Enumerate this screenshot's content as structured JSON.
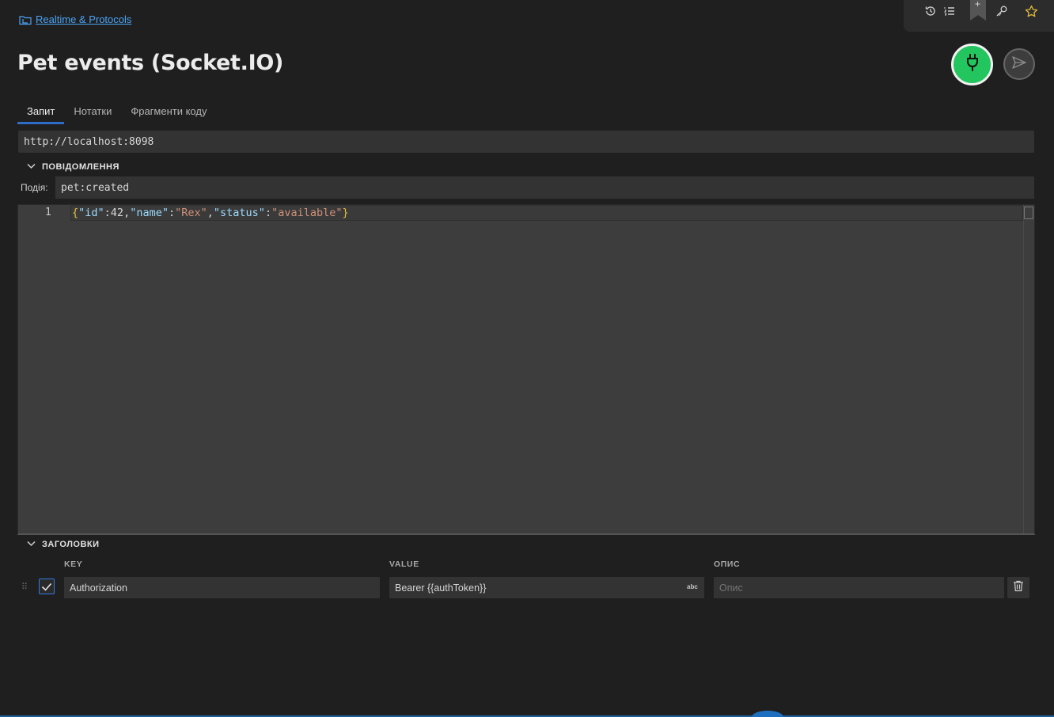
{
  "breadcrumb": {
    "label": "Realtime & Protocols",
    "icon": "folder-link-icon"
  },
  "toolbar": {
    "icons": [
      "history-icon",
      "list-icon",
      "bookmark-icon",
      "key-icon",
      "star-icon"
    ],
    "bookmark_plus": "+"
  },
  "page": {
    "title": "Pet events (Socket.IO)"
  },
  "actions": {
    "connect_icon": "plug-icon",
    "send_icon": "send-icon",
    "connect_color": "#22c55e"
  },
  "tabs": [
    {
      "label": "Запит",
      "active": true
    },
    {
      "label": "Нотатки",
      "active": false
    },
    {
      "label": "Фрагменти коду",
      "active": false
    }
  ],
  "url": {
    "value": "http://localhost:8098"
  },
  "message": {
    "section_label": "ПОВІДОМЛЕННЯ",
    "event_label": "Подія:",
    "event_value": "pet:created",
    "line_number": "1",
    "code": "{\"id\":42,\"name\":\"Rex\",\"status\":\"available\"}"
  },
  "headers": {
    "section_label": "ЗАГОЛОВКИ",
    "columns": {
      "key": "KEY",
      "value": "VALUE",
      "description": "ОПИС"
    },
    "rows": [
      {
        "enabled": true,
        "key": "Authorization",
        "value": "Bearer {{authToken}}",
        "value_badge": "abc",
        "description_placeholder": "Опис",
        "description": ""
      }
    ]
  },
  "colors": {
    "accent": "#2e6cc9",
    "link": "#4ba3f5",
    "background": "#1f1f1f"
  }
}
